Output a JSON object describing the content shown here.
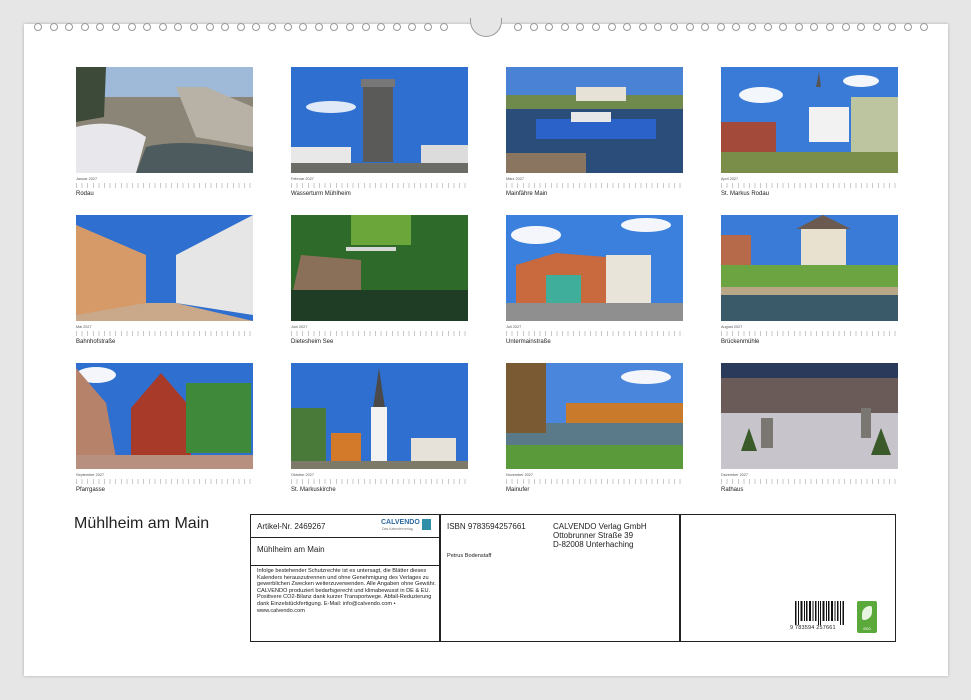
{
  "calendar_title": "Mühlheim am Main",
  "months": [
    {
      "label": "Januar 2027",
      "caption": "Rodau"
    },
    {
      "label": "Februar 2027",
      "caption": "Wasserturm Mühlheim"
    },
    {
      "label": "März 2027",
      "caption": "Mainfähre Main"
    },
    {
      "label": "April 2027",
      "caption": "St. Markus Rodau"
    },
    {
      "label": "Mai 2027",
      "caption": "Bahnhofstraße"
    },
    {
      "label": "Juni 2027",
      "caption": "Dietesheim See"
    },
    {
      "label": "Juli 2027",
      "caption": "Untermainstraße"
    },
    {
      "label": "August 2027",
      "caption": "Brückenmühle"
    },
    {
      "label": "September 2027",
      "caption": "Pfarrgasse"
    },
    {
      "label": "Oktober 2027",
      "caption": "St. Markuskirche"
    },
    {
      "label": "November 2027",
      "caption": "Mainufer"
    },
    {
      "label": "Dezember 2027",
      "caption": "Rathaus"
    }
  ],
  "info": {
    "article": "Artikel-Nr. 2469267",
    "brand": "CALVENDO",
    "brand_sub": "Das Kalenderverlag",
    "product_title": "Mühlheim am Main",
    "legal": "Infolge bestehender Schutzrechte ist es untersagt, die Blätter dieses Kalenders herauszutrennen und ohne Genehmigung des Verlages zu gewerblichen Zwecken weiterzuverwenden. Alle Angaben ohne Gewähr. CALVENDO produziert bedarfsgerecht und klimabewusst in DE & EU. Positivere CO2-Bilanz dank kurzer Transportwege. Abfall-Reduzierung dank Einzelstückfertigung. E-Mail: info@calvendo.com • www.calvendo.com",
    "isbn": "ISBN 9783594257661",
    "publisher_name": "CALVENDO Verlag GmbH",
    "publisher_street": "Ottobrunner Straße 39",
    "publisher_city": "D-82008 Unterhaching",
    "author": "Petrus Bodenstaff",
    "barcode_number": "9 783594 257661",
    "eco_label": "eco"
  },
  "colors": {
    "brand_green": "#5aa93a",
    "sky": "#2f6fd0"
  }
}
